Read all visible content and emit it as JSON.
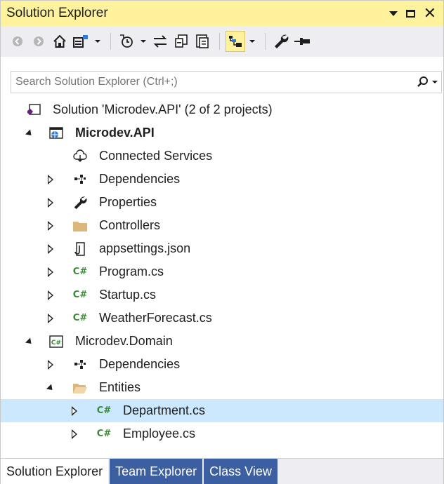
{
  "panel": {
    "title": "Solution Explorer",
    "controls": [
      "pin-dropdown-icon",
      "maximize-icon",
      "close-icon"
    ]
  },
  "toolbar": {
    "buttons": [
      "back-icon",
      "forward-icon",
      "home-icon",
      "switch-views-icon",
      "pending-changes-filter-icon",
      "sync-active-document-icon",
      "collapse-all-icon",
      "show-all-files-icon",
      "preview-selected-items-icon",
      "properties-icon",
      "pin-icon"
    ]
  },
  "search": {
    "placeholder": "Search Solution Explorer (Ctrl+;)"
  },
  "tree": {
    "solution": "Solution 'Microdev.API' (2 of 2 projects)",
    "project1": {
      "name": "Microdev.API",
      "items": [
        "Connected Services",
        "Dependencies",
        "Properties",
        "Controllers",
        "appsettings.json",
        "Program.cs",
        "Startup.cs",
        "WeatherForecast.cs"
      ]
    },
    "project2": {
      "name": "Microdev.Domain",
      "items": [
        "Dependencies",
        "Entities"
      ],
      "entities": [
        "Department.cs",
        "Employee.cs"
      ]
    }
  },
  "tabs": [
    "Solution Explorer",
    "Team Explorer",
    "Class View"
  ],
  "colors": {
    "title_bar": "#fff29d",
    "toolbar": "#eeeef2",
    "selection": "#cce8ff",
    "tab_inactive": "#3b5fa1",
    "csharp_green": "#388a34"
  }
}
